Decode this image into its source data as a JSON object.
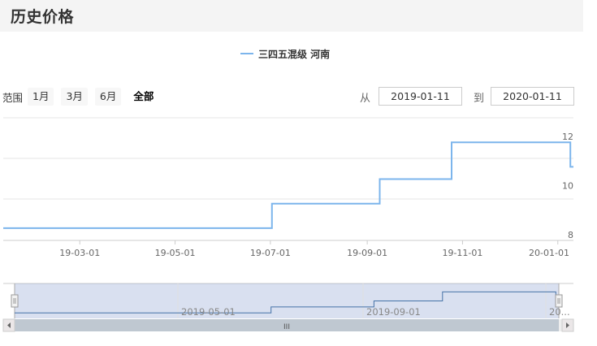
{
  "page": {
    "title": "历史价格"
  },
  "legend": {
    "label": "三四五混级 河南",
    "color": "#7cb5ec"
  },
  "range_selector": {
    "label": "范围",
    "buttons": [
      {
        "label": "1月",
        "active": false
      },
      {
        "label": "3月",
        "active": false
      },
      {
        "label": "6月",
        "active": false
      },
      {
        "label": "全部",
        "active": true
      }
    ]
  },
  "date_range": {
    "from_label": "从",
    "from_value": "2019-01-11",
    "to_label": "到",
    "to_value": "2020-01-11"
  },
  "navigator": {
    "labels": [
      "2019-05-01",
      "2019-09-01",
      "20..."
    ],
    "scroll_grip": "III"
  },
  "chart_data": {
    "type": "line",
    "series": [
      {
        "name": "三四五混级 河南",
        "step": true,
        "points": [
          [
            "2019-01-11",
            8.5
          ],
          [
            "2019-07-02",
            9.5
          ],
          [
            "2019-09-09",
            10.5
          ],
          [
            "2019-10-25",
            12
          ],
          [
            "2020-01-09",
            11
          ]
        ]
      }
    ],
    "x_axis": {
      "min": "2019-01-11",
      "max": "2020-01-11",
      "tick_labels": [
        "19-03-01",
        "19-05-01",
        "19-07-01",
        "19-09-01",
        "19-11-01",
        "20-01-01"
      ]
    },
    "y_axis": {
      "min": 8,
      "max": 13,
      "tick_labels": [
        "8",
        "10",
        "12"
      ],
      "position": "right"
    },
    "grid": true,
    "legend_position": "top-center"
  }
}
